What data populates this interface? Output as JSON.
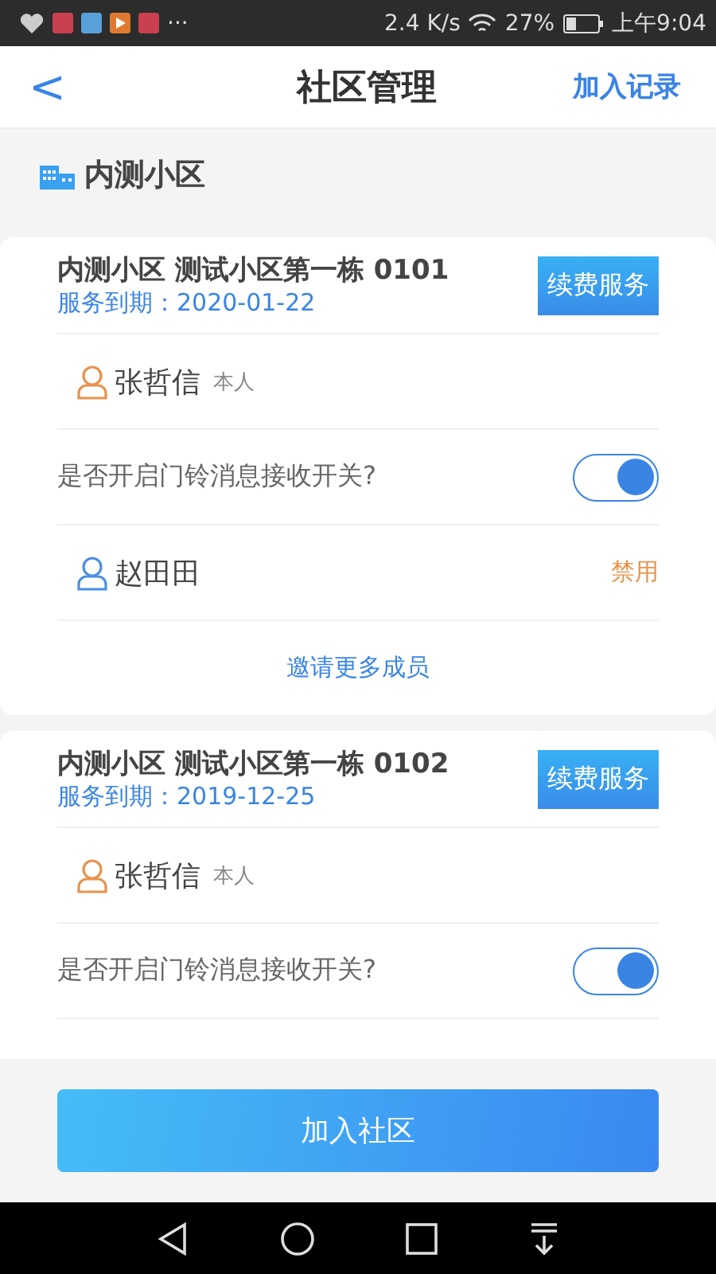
{
  "status_bar": {
    "more": "···",
    "speed": "2.4 K/s",
    "battery": "27%",
    "time": "上午9:04"
  },
  "header": {
    "back": "<",
    "title": "社区管理",
    "action": "加入记录"
  },
  "community": {
    "name": "内测小区"
  },
  "cards": [
    {
      "title": "内测小区 测试小区第一栋 0101",
      "expiry": "服务到期：2020-01-22",
      "renew": "续费服务",
      "rows": [
        {
          "kind": "member",
          "color": "#e8924a",
          "name": "张哲信",
          "tag": "本人"
        },
        {
          "kind": "toggle",
          "label": "是否开启门铃消息接收开关?",
          "on": true
        },
        {
          "kind": "member",
          "color": "#4a8fe0",
          "name": "赵田田",
          "action": "禁用"
        },
        {
          "kind": "invite",
          "label": "邀请更多成员"
        }
      ]
    },
    {
      "title": "内测小区 测试小区第一栋 0102",
      "expiry": "服务到期：2019-12-25",
      "renew": "续费服务",
      "rows": [
        {
          "kind": "member",
          "color": "#e8924a",
          "name": "张哲信",
          "tag": "本人"
        },
        {
          "kind": "toggle",
          "label": "是否开启门铃消息接收开关?",
          "on": true
        }
      ]
    }
  ],
  "join_button": "加入社区"
}
